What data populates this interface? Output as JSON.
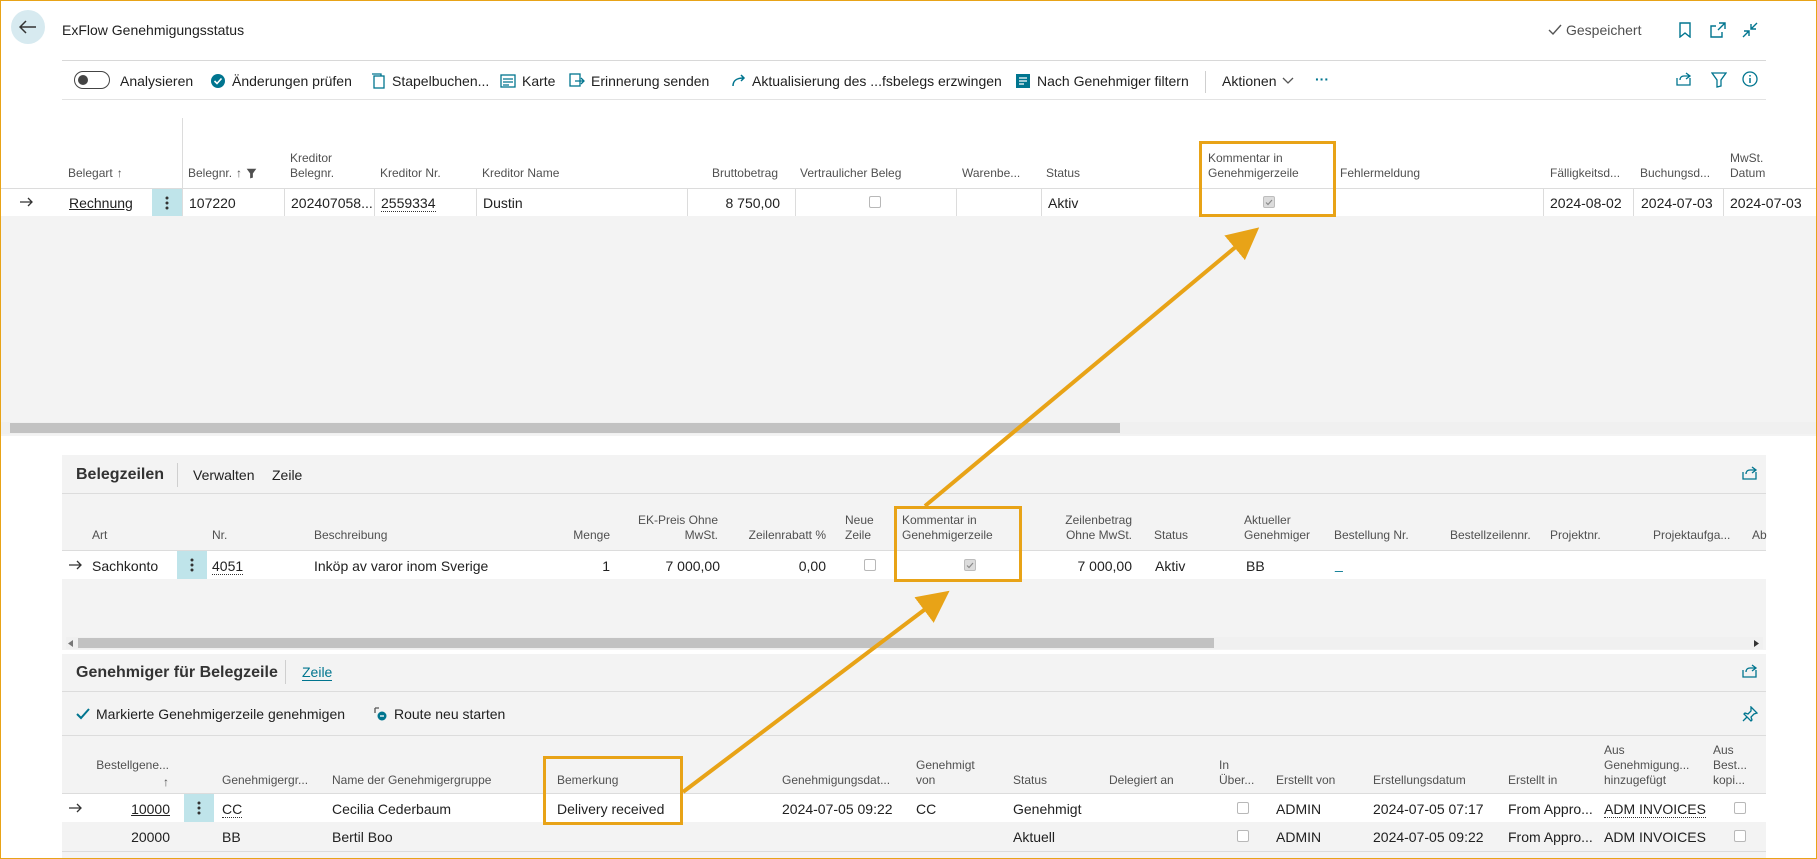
{
  "page": {
    "title": "ExFlow Genehmigungsstatus",
    "saved_label": "Gespeichert"
  },
  "actions": {
    "analyze_label": "Analysieren",
    "check_changes": "Änderungen prüfen",
    "batch_post": "Stapelbuchen...",
    "card": "Karte",
    "send_reminder": "Erinnerung senden",
    "force_update": "Aktualisierung des ...fsbelegs erzwingen",
    "filter_approver": "Nach Genehmiger filtern",
    "actions_menu": "Aktionen",
    "more": "···"
  },
  "main_list": {
    "columns": {
      "doc_type": "Belegart",
      "doc_no": "Belegnr.",
      "vendor_doc_no": "Kreditor Belegnr.",
      "vendor_no": "Kreditor Nr.",
      "vendor_name": "Kreditor Name",
      "gross_amount": "Bruttobetrag",
      "confidential": "Vertraulicher Beleg",
      "goods_receipt": "Warenbe...",
      "status": "Status",
      "comment": "Kommentar in Genehmigerzeile",
      "error": "Fehlermeldung",
      "due_date": "Fälligkeitsd...",
      "posting_date": "Buchungsd...",
      "vat_date": "MwSt. Datum"
    },
    "row": {
      "doc_type": "Rechnung",
      "doc_no": "107220",
      "vendor_doc_no": "202407058...",
      "vendor_no": "2559334",
      "vendor_name": "Dustin",
      "gross_amount": "8 750,00",
      "confidential": false,
      "status": "Aktiv",
      "comment": true,
      "due_date": "2024-08-02",
      "posting_date": "2024-07-03",
      "vat_date": "2024-07-03"
    }
  },
  "lines_panel": {
    "title": "Belegzeilen",
    "tabs": [
      "Verwalten",
      "Zeile"
    ],
    "columns": {
      "type": "Art",
      "no": "Nr.",
      "description": "Beschreibung",
      "quantity": "Menge",
      "unit_price": "EK-Preis Ohne MwSt.",
      "line_discount": "Zeilenrabatt %",
      "new_line": "Neue Zeile",
      "comment": "Kommentar in Genehmigerzeile",
      "line_amount": "Zeilenbetrag Ohne MwSt.",
      "status": "Status",
      "current_approver": "Aktueller Genehmiger",
      "order_no": "Bestellung Nr.",
      "order_line_no": "Bestellzeilennr.",
      "project_no": "Projektnr.",
      "project_task": "Projektaufga...",
      "extra": "Ab"
    },
    "row": {
      "type": "Sachkonto",
      "no": "4051",
      "description": "Inköp av varor inom Sverige",
      "quantity": "1",
      "unit_price": "7 000,00",
      "line_discount": "0,00",
      "new_line": false,
      "comment": true,
      "line_amount": "7 000,00",
      "status": "Aktiv",
      "current_approver": "BB",
      "order_no": "_"
    }
  },
  "approvers_panel": {
    "title": "Genehmiger für Belegzeile",
    "tab": "Zeile",
    "actions": {
      "approve": "Markierte Genehmigerzeile genehmigen",
      "restart": "Route neu starten"
    },
    "columns": {
      "order_line": "Bestellgene...",
      "group": "Genehmigergr...",
      "group_name": "Name der Genehmigergruppe",
      "remark": "Bemerkung",
      "approval_date": "Genehmigungsdat...",
      "approved_by": "Genehmigt von",
      "status": "Status",
      "delegated_to": "Delegiert an",
      "in_review": "In Über...",
      "created_by": "Erstellt von",
      "created_date": "Erstellungsdatum",
      "created_in": "Erstellt in",
      "added_from": "Aus Genehmigung... hinzugefügt",
      "copied_from": "Aus Best... kopi..."
    },
    "rows": [
      {
        "order_line": "10000",
        "group": "CC",
        "group_name": "Cecilia Cederbaum",
        "remark": "Delivery received",
        "approval_date": "2024-07-05 09:22",
        "approved_by": "CC",
        "status": "Genehmigt",
        "created_by": "ADMIN",
        "created_date": "2024-07-05 07:17",
        "created_in": "From Appro...",
        "added_from": "ADM INVOICES"
      },
      {
        "order_line": "20000",
        "group": "BB",
        "group_name": "Bertil Boo",
        "remark": "",
        "approval_date": "",
        "approved_by": "",
        "status": "Aktuell",
        "created_by": "ADMIN",
        "created_date": "2024-07-05 09:22",
        "created_in": "From Appro...",
        "added_from": "ADM INVOICES"
      }
    ]
  },
  "colors": {
    "accent": "#00758f",
    "highlight": "#e8a317",
    "selection": "#bfe4ea"
  }
}
